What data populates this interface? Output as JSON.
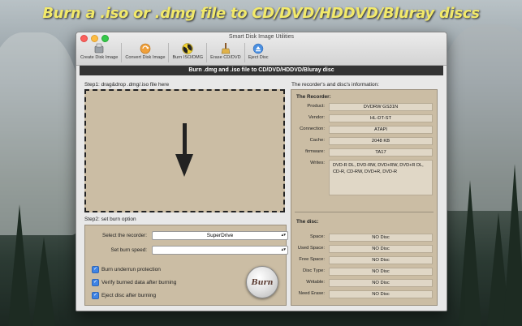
{
  "headline": "Burn a .iso or .dmg file to CD/DVD/HDDVD/Bluray discs",
  "window": {
    "title": "Smart Disk Image Utilities",
    "toolbar": [
      {
        "label": "Create Disk Image",
        "icon": "disk-image-icon"
      },
      {
        "label": "Convert Disk Image",
        "icon": "convert-icon"
      },
      {
        "label": "Burn ISO/DMG",
        "icon": "radiation-icon"
      },
      {
        "label": "Erase CD/DVD",
        "icon": "broom-icon"
      },
      {
        "label": "Eject Disc",
        "icon": "eject-icon"
      }
    ]
  },
  "banner": "Burn .dmg and .iso file to CD/DVD/HDDVD/Bluray disc",
  "step1": {
    "label": "Step1: drag&drop .dmg/.iso file here"
  },
  "step2": {
    "label": "Step2: set burn option",
    "recorder_label": "Select the recorder:",
    "recorder_value": "SuperDrive",
    "speed_label": "Set burn speed:",
    "speed_value": "",
    "options": [
      {
        "label": "Burn underrun protection",
        "checked": true
      },
      {
        "label": "Verify burned data after burning",
        "checked": true
      },
      {
        "label": "Eject disc after burning",
        "checked": true
      }
    ],
    "burn_button": "Burn"
  },
  "info": {
    "heading": "The recorder's and disc's information:",
    "recorder": {
      "title": "The Recorder:",
      "fields": [
        {
          "label": "Product:",
          "value": "DVDRW  GS31N"
        },
        {
          "label": "Vendor:",
          "value": "HL-DT-ST"
        },
        {
          "label": "Connection:",
          "value": "ATAPI"
        },
        {
          "label": "Cache:",
          "value": "2048 KB"
        },
        {
          "label": "firmware:",
          "value": "TA17"
        }
      ],
      "writes_label": "Writes:",
      "writes_value": "DVD-R DL, DVD-RW, DVD+RW, DVD+R DL, CD-R, CD-RW, DVD+R, DVD-R"
    },
    "disc": {
      "title": "The disc:",
      "fields": [
        {
          "label": "Space:",
          "value": "NO Disc"
        },
        {
          "label": "Used Space:",
          "value": "NO Disc"
        },
        {
          "label": "Free Space:",
          "value": "NO Disc"
        },
        {
          "label": "Disc Type:",
          "value": "NO Disc"
        },
        {
          "label": "Writable:",
          "value": "NO Disc"
        },
        {
          "label": "Need Erase:",
          "value": "NO Disc"
        }
      ]
    }
  },
  "colors": {
    "panel": "#cbbda4",
    "banner": "#333333",
    "headline": "#f2e96a"
  }
}
